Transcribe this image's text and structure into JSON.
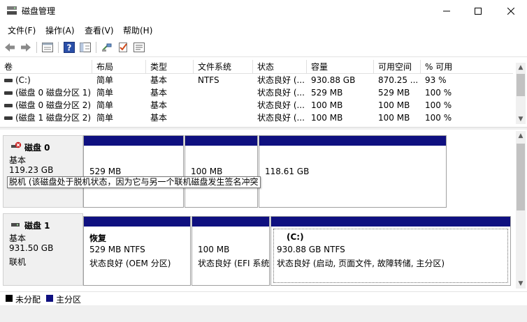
{
  "window": {
    "title": "磁盘管理",
    "controls": {
      "minimize": "minimize-icon",
      "maximize": "maximize-icon",
      "close": "close-icon"
    }
  },
  "menu": {
    "items": [
      {
        "label": "文件(F)"
      },
      {
        "label": "操作(A)"
      },
      {
        "label": "查看(V)"
      },
      {
        "label": "帮助(H)"
      }
    ]
  },
  "toolbar": {
    "icons": [
      "back-arrow-icon",
      "forward-arrow-icon",
      "properties-list-icon",
      "help-icon",
      "show-hide-console-tree-icon",
      "connect-disk-icon",
      "checklist-icon",
      "settings-panel-icon"
    ]
  },
  "volumes": {
    "columns": [
      "卷",
      "布局",
      "类型",
      "文件系统",
      "状态",
      "容量",
      "可用空间",
      "% 可用"
    ],
    "rows": [
      {
        "name": "(C:)",
        "layout": "简单",
        "type": "基本",
        "fs": "NTFS",
        "status": "状态良好 (...",
        "capacity": "930.88 GB",
        "free": "870.25 ...",
        "pct": "93 %"
      },
      {
        "name": "(磁盘 0 磁盘分区 1)",
        "layout": "简单",
        "type": "基本",
        "fs": "",
        "status": "状态良好 (...",
        "capacity": "529 MB",
        "free": "529 MB",
        "pct": "100 %"
      },
      {
        "name": "(磁盘 0 磁盘分区 2)",
        "layout": "简单",
        "type": "基本",
        "fs": "",
        "status": "状态良好 (...",
        "capacity": "100 MB",
        "free": "100 MB",
        "pct": "100 %"
      },
      {
        "name": "(磁盘 1 磁盘分区 2)",
        "layout": "简单",
        "type": "基本",
        "fs": "",
        "status": "状态良好 (...",
        "capacity": "100 MB",
        "free": "100 MB",
        "pct": "100 %"
      }
    ]
  },
  "disks": [
    {
      "title": "磁盘 0",
      "type": "基本",
      "size": "119.23 GB",
      "status": "",
      "icon": "offline-disk-icon",
      "partitions": [
        {
          "name": "",
          "line1": "529 MB",
          "line2": ""
        },
        {
          "name": "",
          "line1": "100 MB",
          "line2": ""
        },
        {
          "name": "",
          "line1": "118.61 GB",
          "line2": ""
        }
      ]
    },
    {
      "title": "磁盘 1",
      "type": "基本",
      "size": "931.50 GB",
      "status": "联机",
      "icon": "disk-icon",
      "partitions": [
        {
          "name": "恢复",
          "line1": "529 MB NTFS",
          "line2": "状态良好 (OEM 分区)"
        },
        {
          "name": "",
          "line1": "100 MB",
          "line2": "状态良好 (EFI 系统"
        },
        {
          "name": "(C:)",
          "line1": "930.88 GB NTFS",
          "line2": "状态良好 (启动, 页面文件, 故障转储, 主分区)"
        }
      ]
    }
  ],
  "tooltip": "脱机 (该磁盘处于脱机状态，因为它与另一个联机磁盘发生签名冲突",
  "legend": [
    {
      "label": "未分配",
      "color": "#000000"
    },
    {
      "label": "主分区",
      "color": "#0f1080"
    }
  ],
  "colors": {
    "partition_bar": "#0f1080",
    "offline_badge": "#c81e1e"
  }
}
